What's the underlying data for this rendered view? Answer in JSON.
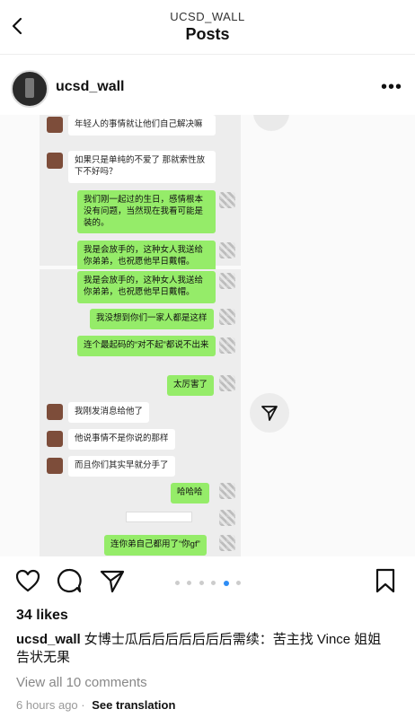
{
  "header": {
    "account": "UCSD_WALL",
    "title": "Posts"
  },
  "post": {
    "username": "ucsd_wall",
    "likes": "34 likes",
    "caption_user": "ucsd_wall",
    "caption_text": "女博士瓜后后后后后后后需续：苦主找 Vince 姐姐告状无果",
    "comments_link": "View all 10 comments",
    "time": "6 hours ago",
    "translation": "See translation"
  },
  "chat_top": [
    {
      "side": "left",
      "text": "年轻人的事情就让他们自己解决嘛"
    },
    {
      "side": "left",
      "text": "如果只是单纯的不爱了 那就索性放下不好吗？"
    },
    {
      "side": "right",
      "text": "我们刚一起过的生日，感情根本没有问题，当然现在我看可能是装的。"
    },
    {
      "side": "right",
      "text": "我是会放手的，这种女人我送给你弟弟，也祝愿他早日戴帽。"
    }
  ],
  "chat_bottom": [
    {
      "side": "right",
      "text": "我是会放手的，这种女人我送给你弟弟，也祝愿他早日戴帽。"
    },
    {
      "side": "right",
      "text": "我没想到你们一家人都是这样"
    },
    {
      "side": "right",
      "text": "连个最起码的“对不起”都说不出来"
    },
    {
      "side": "right",
      "text": "太厉害了"
    },
    {
      "side": "left",
      "text": "我刚发消息给他了"
    },
    {
      "side": "left",
      "text": "他说事情不是你说的那样"
    },
    {
      "side": "left",
      "text": "而且你们其实早就分手了"
    },
    {
      "side": "right",
      "text": "哈哈哈"
    },
    {
      "side": "right",
      "text": "连你弟自己都用了“你gf”"
    }
  ],
  "carousel": {
    "count": 6,
    "active": 5
  },
  "colors": {
    "bubble_right": "#95ec69",
    "bubble_left": "#ffffff",
    "accent": "#2e8df5"
  }
}
